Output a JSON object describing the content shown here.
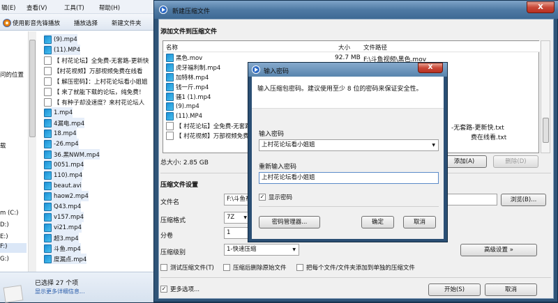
{
  "explorer": {
    "menu": [
      "辑(E)",
      "查看(V)",
      "工具(T)",
      "帮助(H)"
    ],
    "toolbar": [
      "使用影音先锋播放",
      "播放选择",
      "新建文件夹"
    ],
    "nav": [
      "问的位置",
      "载",
      "m (C:)",
      "D:)",
      "E:)",
      "F:)",
      "G:)"
    ],
    "files": [
      "(9).mp4",
      "(11).MP4",
      "【 村花论坛】全免费-无套路-更新快",
      "【村花视频】万部视频免费在线看",
      "【 解压密码】：上村花论坛看小姐姐",
      "【 来了就能下载的论坛，纯免费！",
      "【 有种子却没速度？来村花论坛人",
      "1.mp4",
      "4漏电.mp4",
      "18.mp4",
      "-26.mp4",
      "36.黑NWM.mp4",
      "0051.mp4",
      "110).mp4",
      "beaut.avi",
      "haow2.mp4",
      "Q43.mp4",
      "v157.mp4",
      "vi21.mp4",
      "超3.mp4",
      "斗鱼.mp4",
      "度漏点.mp4"
    ],
    "status_selected": "已选择 27 个项",
    "status_more": "显示更多详细信息..."
  },
  "dialog": {
    "title": "新建压缩文件",
    "close": "X",
    "section_add": "添加文件到压缩文件",
    "col_name": "名称",
    "col_size": "大小",
    "col_path": "文件路径",
    "rows": [
      {
        "name": "黑色.mov",
        "size": "92.7 MB",
        "path": "F:\\斗鱼视频\\黑色.mov"
      },
      {
        "name": "虎牙福利制.mp4",
        "size": "",
        "path": ""
      },
      {
        "name": "加特林.mp4",
        "size": "",
        "path": ""
      },
      {
        "name": "钱一斤.mp4",
        "size": "",
        "path": ""
      },
      {
        "name": "骚1 (1).mp4",
        "size": "",
        "path": ""
      },
      {
        "name": "(9).mp4",
        "size": "",
        "path": ""
      },
      {
        "name": "(11).MP4",
        "size": "",
        "path": ""
      },
      {
        "name": "【 村花论坛】全免费-无套路-",
        "size": "",
        "path": "-无套路-更新快.txt"
      },
      {
        "name": "【 村花视频】万部视频免费在线",
        "size": "",
        "path": "费在线看.txt"
      }
    ],
    "total": "总大小: 2.85 GB",
    "add_btn": "添加(A)",
    "remove_btn": "删除(D)",
    "settings_title": "压缩文件设置",
    "filename_label": "文件名",
    "filename_value": "F:\\斗鱼视",
    "browse_btn": "浏览(B)...",
    "format_label": "压缩格式",
    "format_value": "7Z",
    "split_label": "分卷",
    "split_value": "1",
    "level_label": "压缩级别",
    "level_value": "1-快速压缩",
    "advanced_btn": "高级设置 »",
    "test_chk": "测试压缩文件(T)",
    "delete_chk": "压缩后删除原始文件",
    "separate_chk": "把每个文件/文件夹添加到单独的压缩文件",
    "more_chk": "更多选项...",
    "start_btn": "开始(S)",
    "cancel_btn": "取消"
  },
  "password": {
    "title": "输入密码",
    "close": "X",
    "hint": "输入压缩包密码。建议使用至少 8 位的密码来保证安全性。",
    "enter_label": "输入密码",
    "enter_value": "上村花论坛看小姐姐",
    "reenter_label": "重新输入密码",
    "reenter_value": "上村花论坛看小姐姐",
    "show_chk": "显示密码",
    "manager_btn": "密码管理器...",
    "ok_btn": "确定",
    "cancel_btn": "取消"
  }
}
